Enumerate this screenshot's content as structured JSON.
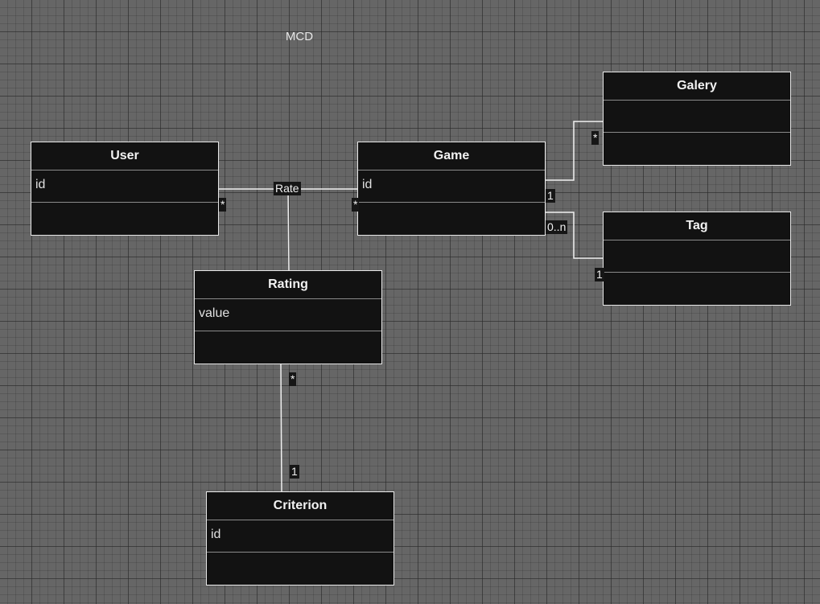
{
  "diagram": {
    "title": "MCD"
  },
  "entities": {
    "user": {
      "name": "User",
      "attributes": "id"
    },
    "game": {
      "name": "Game",
      "attributes": "id"
    },
    "galery": {
      "name": "Galery",
      "attributes": ""
    },
    "tag": {
      "name": "Tag",
      "attributes": ""
    },
    "rating": {
      "name": "Rating",
      "attributes": "value"
    },
    "criterion": {
      "name": "Criterion",
      "attributes": "id"
    }
  },
  "relations": {
    "rate": {
      "label": "Rate",
      "user_multiplicity": "*",
      "game_multiplicity": "*"
    },
    "game_galery": {
      "game_multiplicity": "1",
      "galery_multiplicity": "*"
    },
    "game_tag": {
      "game_multiplicity": "0..n",
      "tag_multiplicity": "1"
    },
    "rating_criterion": {
      "rating_multiplicity": "*",
      "criterion_multiplicity": "1"
    }
  },
  "colors": {
    "canvas": "#666666",
    "entity_fill": "#121212",
    "entity_border": "#e8e8e8",
    "connector": "#f0f0f0"
  }
}
